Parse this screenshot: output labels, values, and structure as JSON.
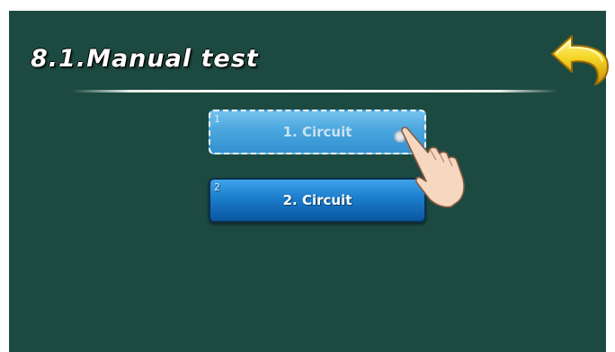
{
  "header": {
    "title": "8.1.Manual test"
  },
  "buttons": [
    {
      "number": "1",
      "label": "1. Circuit",
      "state": "pressed"
    },
    {
      "number": "2",
      "label": "2. Circuit",
      "state": "normal"
    }
  ],
  "icons": {
    "back": "back-arrow-icon",
    "hand": "pointing-hand-icon"
  },
  "colors": {
    "background": "#1c4a41",
    "button_blue": "#1b7dcc",
    "back_arrow": "#f4d12a"
  }
}
